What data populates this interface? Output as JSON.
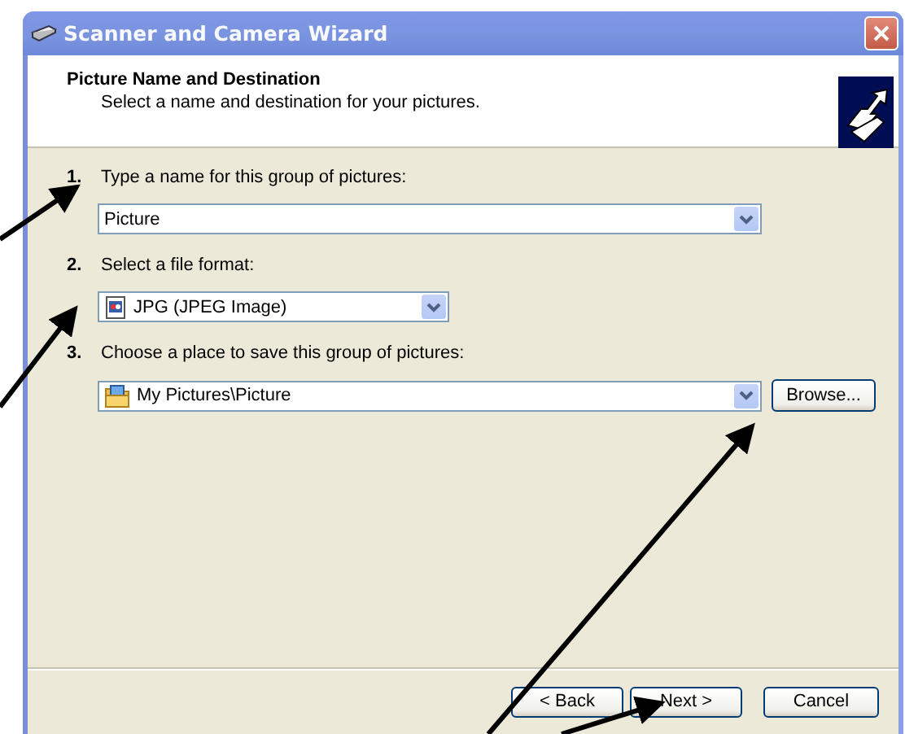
{
  "window": {
    "title": "Scanner and Camera Wizard"
  },
  "header": {
    "title": "Picture Name and Destination",
    "subtitle": "Select a name and destination for your pictures."
  },
  "steps": [
    {
      "number": "1.",
      "label": "Type a name for this group of pictures:",
      "field": {
        "kind": "text",
        "value": "Picture"
      }
    },
    {
      "number": "2.",
      "label": "Select a file format:",
      "field": {
        "kind": "format",
        "value": "JPG (JPEG Image)"
      }
    },
    {
      "number": "3.",
      "label": "Choose a place to save this group of pictures:",
      "field": {
        "kind": "folder",
        "value": "My Pictures\\Picture"
      },
      "button": "Browse..."
    }
  ],
  "buttons": [
    {
      "label": "< Back"
    },
    {
      "label": "Next >"
    },
    {
      "label": "Cancel"
    }
  ]
}
